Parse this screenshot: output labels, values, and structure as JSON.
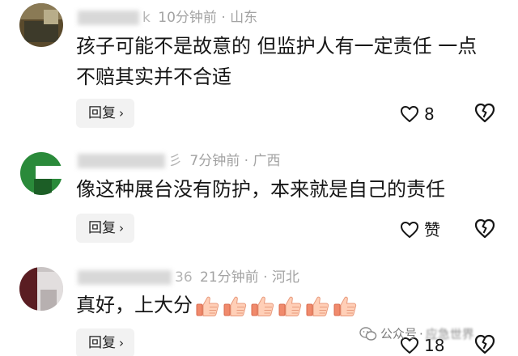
{
  "comments": [
    {
      "handle_tail": "k",
      "time": "10分钟前",
      "dot": "·",
      "location": "山东",
      "lines": [
        "孩子可能不是故意的 但监护人有一定责任 一点",
        "不赔其实并不合适"
      ],
      "reply_label": "回复",
      "likes": "8"
    },
    {
      "handle_tail": "彡",
      "time": "7分钟前",
      "dot": "·",
      "location": "广西",
      "lines": [
        "像这种展台没有防护，本来就是自己的责任"
      ],
      "reply_label": "回复",
      "likes": "赞"
    },
    {
      "handle_tail": "36",
      "time": "21分钟前",
      "dot": "·",
      "location": "河北",
      "lines": [
        "真好，上大分"
      ],
      "reply_label": "回复",
      "likes": "18",
      "emoji_count": 6
    }
  ],
  "icons": {
    "chevron": "›",
    "like": "heart-outline-icon",
    "dislike": "broken-heart-icon",
    "emoji": "thumbs-up-emoji"
  },
  "watermark": {
    "prefix": "公众号",
    "dot": "·",
    "name": "应急世界"
  },
  "colors": {
    "text": "#161616",
    "meta": "#a3a3a3",
    "reply_bg": "#f2f2f2",
    "avatar2_green": "#1f7a2e"
  }
}
